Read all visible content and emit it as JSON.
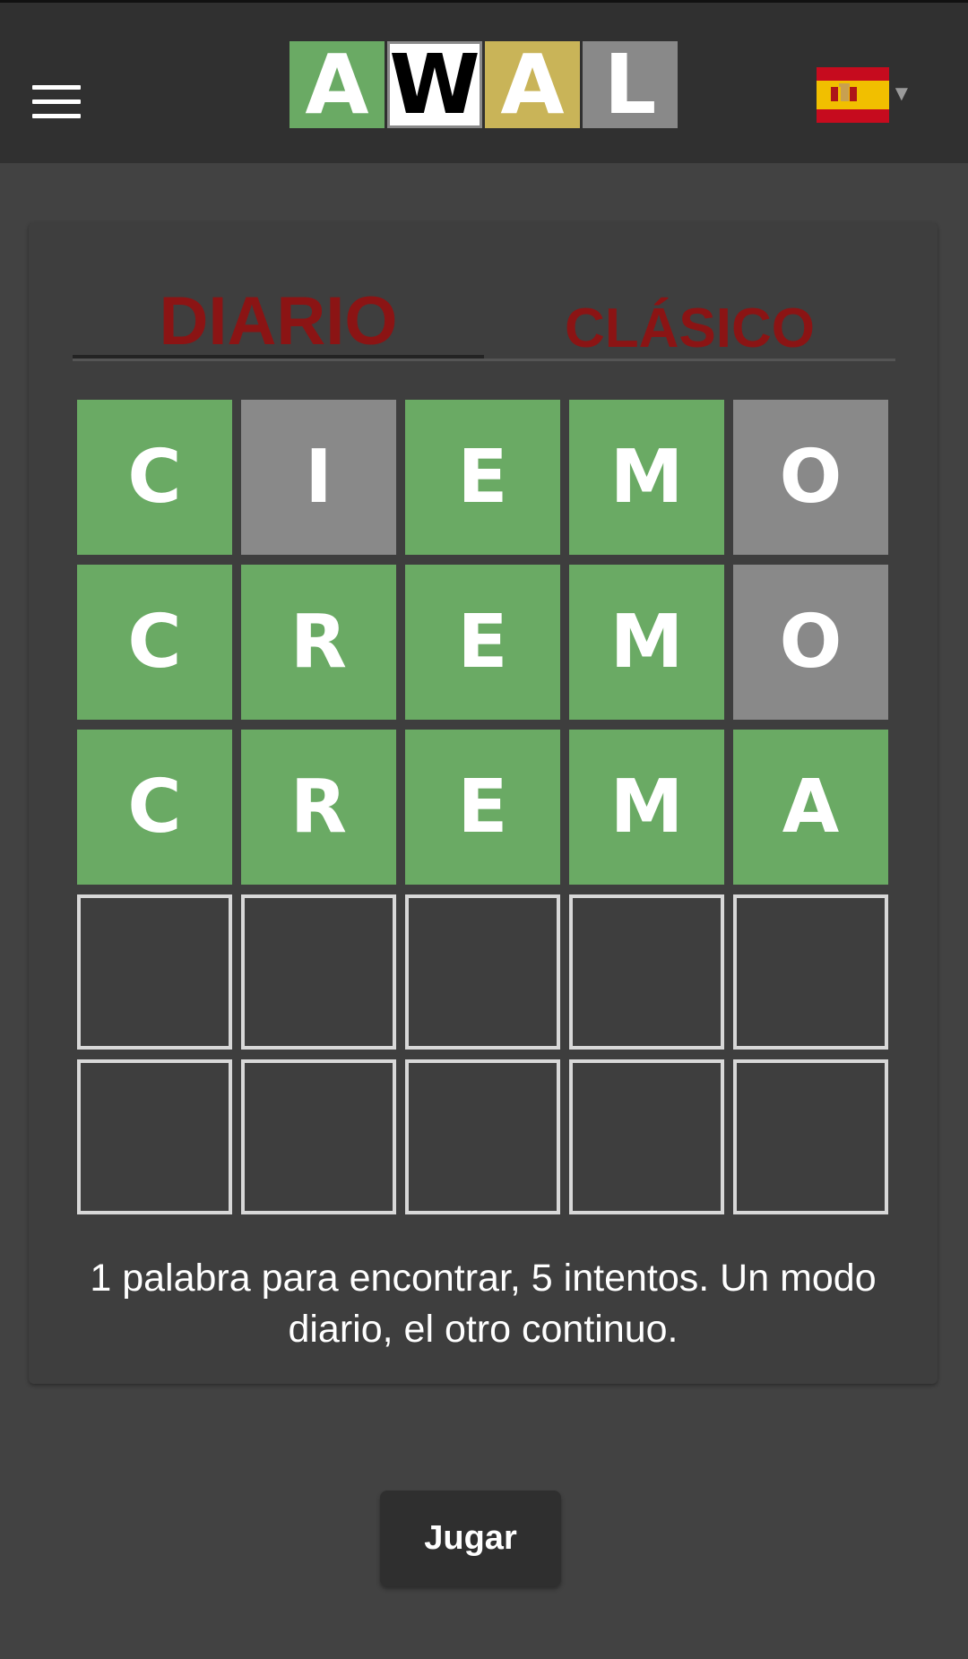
{
  "header": {
    "menu_icon": "hamburger-menu-icon",
    "logo_letters": [
      {
        "letter": "A",
        "color": "#6aaa64"
      },
      {
        "letter": "W",
        "color": "#ffffff"
      },
      {
        "letter": "A",
        "color": "#c9b458"
      },
      {
        "letter": "L",
        "color": "#898989"
      }
    ],
    "language_icon": "spain-flag-icon",
    "language_dropdown_icon": "caret-down-icon"
  },
  "tabs": {
    "daily_label": "DIARIO",
    "classic_label": "CLÁSICO",
    "active": "daily",
    "color": "#8b1414"
  },
  "board": {
    "rows": [
      [
        {
          "letter": "C",
          "state": "correct"
        },
        {
          "letter": "I",
          "state": "absent"
        },
        {
          "letter": "E",
          "state": "correct"
        },
        {
          "letter": "M",
          "state": "correct"
        },
        {
          "letter": "O",
          "state": "absent"
        }
      ],
      [
        {
          "letter": "C",
          "state": "correct"
        },
        {
          "letter": "R",
          "state": "correct"
        },
        {
          "letter": "E",
          "state": "correct"
        },
        {
          "letter": "M",
          "state": "correct"
        },
        {
          "letter": "O",
          "state": "absent"
        }
      ],
      [
        {
          "letter": "C",
          "state": "correct"
        },
        {
          "letter": "R",
          "state": "correct"
        },
        {
          "letter": "E",
          "state": "correct"
        },
        {
          "letter": "M",
          "state": "correct"
        },
        {
          "letter": "A",
          "state": "correct"
        }
      ],
      [
        {
          "letter": "",
          "state": "empty"
        },
        {
          "letter": "",
          "state": "empty"
        },
        {
          "letter": "",
          "state": "empty"
        },
        {
          "letter": "",
          "state": "empty"
        },
        {
          "letter": "",
          "state": "empty"
        }
      ],
      [
        {
          "letter": "",
          "state": "empty"
        },
        {
          "letter": "",
          "state": "empty"
        },
        {
          "letter": "",
          "state": "empty"
        },
        {
          "letter": "",
          "state": "empty"
        },
        {
          "letter": "",
          "state": "empty"
        }
      ]
    ],
    "colors": {
      "correct": "#6aaa64",
      "absent": "#898989",
      "present": "#c9b458"
    }
  },
  "description": "1 palabra para encontrar, 5 intentos. Un modo diario, el otro continuo.",
  "play_button": {
    "label": "Jugar"
  }
}
